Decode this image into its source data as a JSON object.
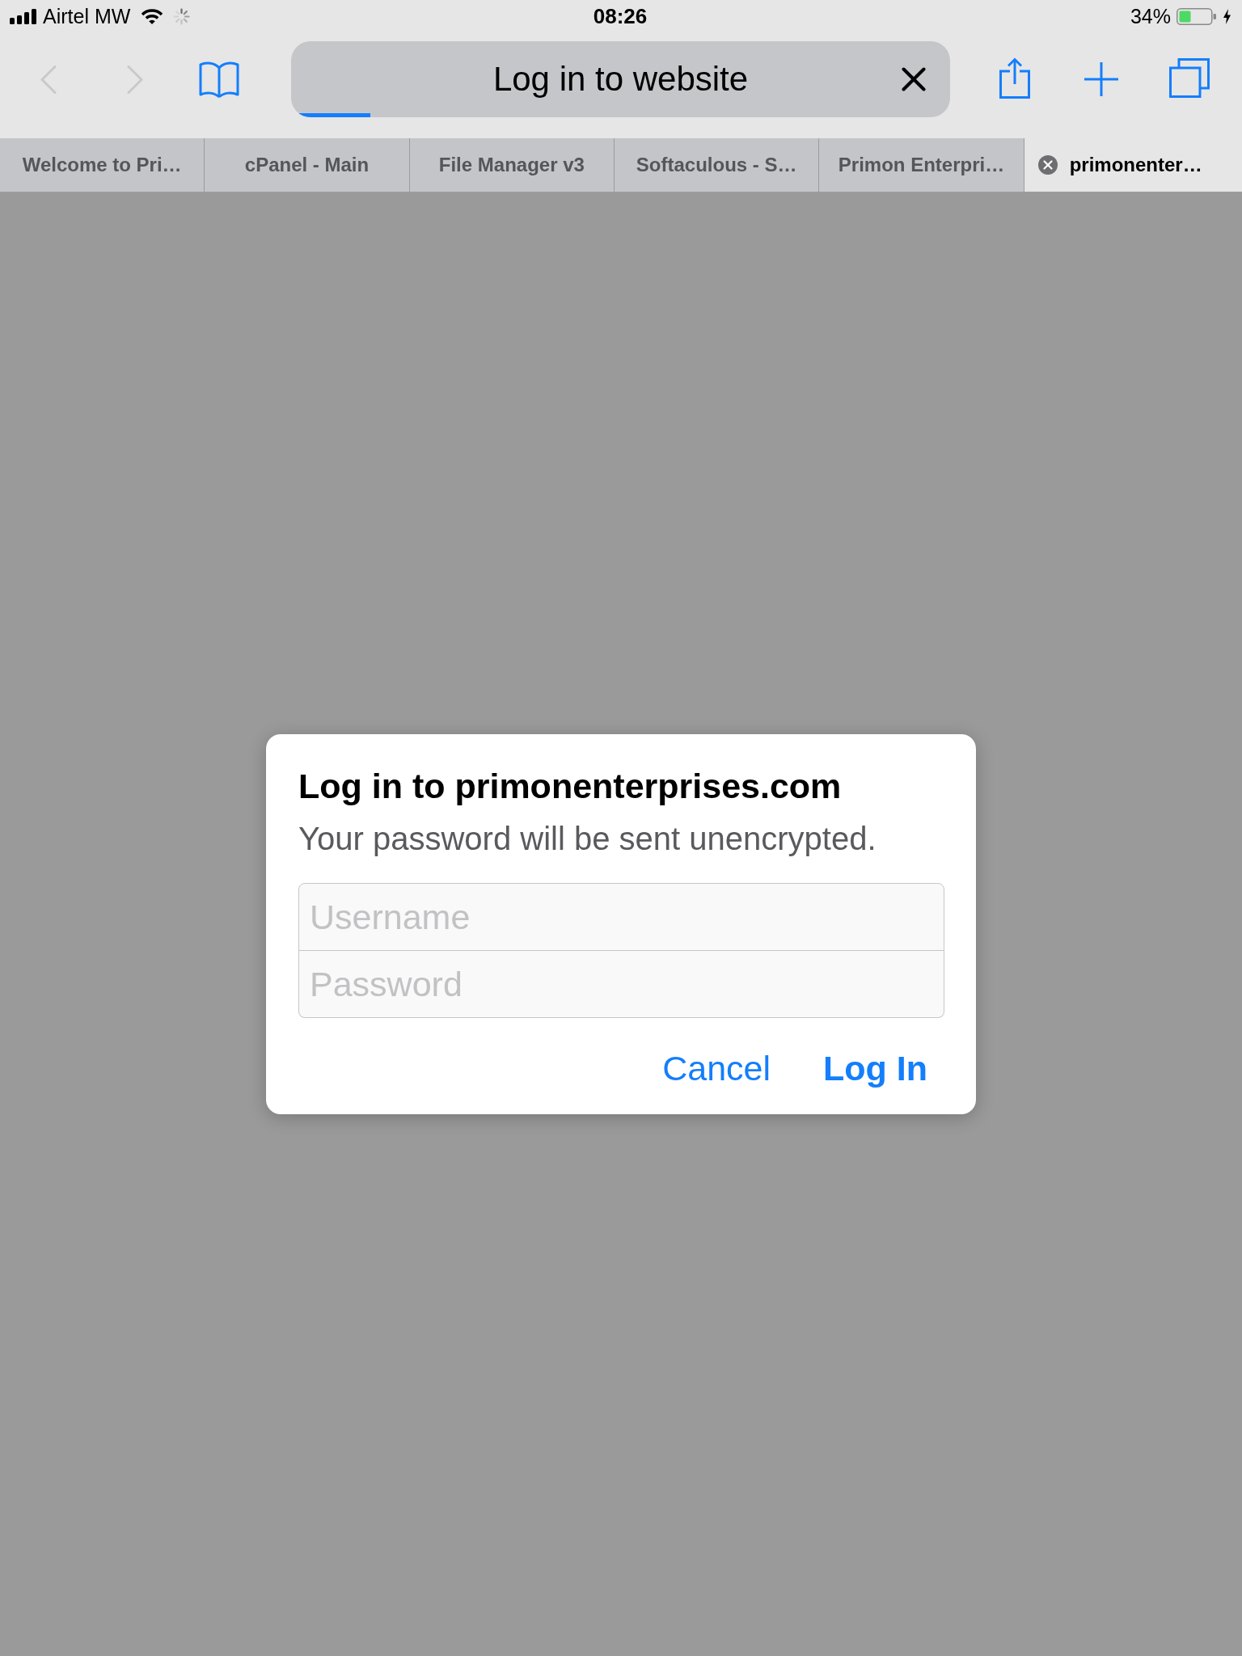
{
  "status_bar": {
    "carrier": "Airtel MW",
    "network_activity": true,
    "time": "08:26",
    "battery_percent": "34%",
    "charging": true
  },
  "toolbar": {
    "back": {
      "disabled": true
    },
    "forward": {
      "disabled": true
    },
    "address_bar": {
      "title": "Log in to website",
      "progress": {
        "level": 0.12
      }
    }
  },
  "tabs": [
    {
      "label": "Welcome to Pri…",
      "selected": false
    },
    {
      "label": "cPanel - Main",
      "selected": false
    },
    {
      "label": "File Manager v3",
      "selected": false
    },
    {
      "label": "Softaculous - S…",
      "selected": false
    },
    {
      "label": "Primon Enterpri…",
      "selected": false
    },
    {
      "label": "primonenter…",
      "selected": true
    }
  ],
  "dialog": {
    "title": "Log in to primonenterprises.com",
    "message": "Your password will be sent unencrypted.",
    "fields": [
      {
        "placeholder": "Username"
      },
      {
        "placeholder": "Password"
      }
    ],
    "buttons": [
      {
        "label": "Cancel",
        "kind": "cancel"
      },
      {
        "label": "Log In",
        "kind": "default"
      }
    ]
  }
}
